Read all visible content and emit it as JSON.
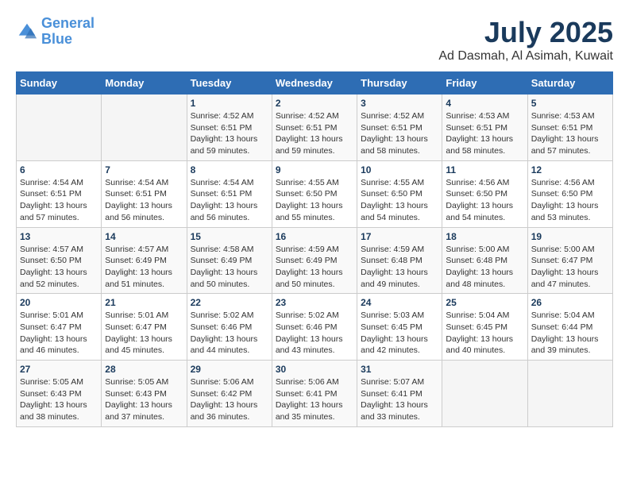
{
  "logo": {
    "line1": "General",
    "line2": "Blue"
  },
  "title": "July 2025",
  "location": "Ad Dasmah, Al Asimah, Kuwait",
  "weekdays": [
    "Sunday",
    "Monday",
    "Tuesday",
    "Wednesday",
    "Thursday",
    "Friday",
    "Saturday"
  ],
  "weeks": [
    [
      {
        "day": "",
        "detail": ""
      },
      {
        "day": "",
        "detail": ""
      },
      {
        "day": "1",
        "detail": "Sunrise: 4:52 AM\nSunset: 6:51 PM\nDaylight: 13 hours\nand 59 minutes."
      },
      {
        "day": "2",
        "detail": "Sunrise: 4:52 AM\nSunset: 6:51 PM\nDaylight: 13 hours\nand 59 minutes."
      },
      {
        "day": "3",
        "detail": "Sunrise: 4:52 AM\nSunset: 6:51 PM\nDaylight: 13 hours\nand 58 minutes."
      },
      {
        "day": "4",
        "detail": "Sunrise: 4:53 AM\nSunset: 6:51 PM\nDaylight: 13 hours\nand 58 minutes."
      },
      {
        "day": "5",
        "detail": "Sunrise: 4:53 AM\nSunset: 6:51 PM\nDaylight: 13 hours\nand 57 minutes."
      }
    ],
    [
      {
        "day": "6",
        "detail": "Sunrise: 4:54 AM\nSunset: 6:51 PM\nDaylight: 13 hours\nand 57 minutes."
      },
      {
        "day": "7",
        "detail": "Sunrise: 4:54 AM\nSunset: 6:51 PM\nDaylight: 13 hours\nand 56 minutes."
      },
      {
        "day": "8",
        "detail": "Sunrise: 4:54 AM\nSunset: 6:51 PM\nDaylight: 13 hours\nand 56 minutes."
      },
      {
        "day": "9",
        "detail": "Sunrise: 4:55 AM\nSunset: 6:50 PM\nDaylight: 13 hours\nand 55 minutes."
      },
      {
        "day": "10",
        "detail": "Sunrise: 4:55 AM\nSunset: 6:50 PM\nDaylight: 13 hours\nand 54 minutes."
      },
      {
        "day": "11",
        "detail": "Sunrise: 4:56 AM\nSunset: 6:50 PM\nDaylight: 13 hours\nand 54 minutes."
      },
      {
        "day": "12",
        "detail": "Sunrise: 4:56 AM\nSunset: 6:50 PM\nDaylight: 13 hours\nand 53 minutes."
      }
    ],
    [
      {
        "day": "13",
        "detail": "Sunrise: 4:57 AM\nSunset: 6:50 PM\nDaylight: 13 hours\nand 52 minutes."
      },
      {
        "day": "14",
        "detail": "Sunrise: 4:57 AM\nSunset: 6:49 PM\nDaylight: 13 hours\nand 51 minutes."
      },
      {
        "day": "15",
        "detail": "Sunrise: 4:58 AM\nSunset: 6:49 PM\nDaylight: 13 hours\nand 50 minutes."
      },
      {
        "day": "16",
        "detail": "Sunrise: 4:59 AM\nSunset: 6:49 PM\nDaylight: 13 hours\nand 50 minutes."
      },
      {
        "day": "17",
        "detail": "Sunrise: 4:59 AM\nSunset: 6:48 PM\nDaylight: 13 hours\nand 49 minutes."
      },
      {
        "day": "18",
        "detail": "Sunrise: 5:00 AM\nSunset: 6:48 PM\nDaylight: 13 hours\nand 48 minutes."
      },
      {
        "day": "19",
        "detail": "Sunrise: 5:00 AM\nSunset: 6:47 PM\nDaylight: 13 hours\nand 47 minutes."
      }
    ],
    [
      {
        "day": "20",
        "detail": "Sunrise: 5:01 AM\nSunset: 6:47 PM\nDaylight: 13 hours\nand 46 minutes."
      },
      {
        "day": "21",
        "detail": "Sunrise: 5:01 AM\nSunset: 6:47 PM\nDaylight: 13 hours\nand 45 minutes."
      },
      {
        "day": "22",
        "detail": "Sunrise: 5:02 AM\nSunset: 6:46 PM\nDaylight: 13 hours\nand 44 minutes."
      },
      {
        "day": "23",
        "detail": "Sunrise: 5:02 AM\nSunset: 6:46 PM\nDaylight: 13 hours\nand 43 minutes."
      },
      {
        "day": "24",
        "detail": "Sunrise: 5:03 AM\nSunset: 6:45 PM\nDaylight: 13 hours\nand 42 minutes."
      },
      {
        "day": "25",
        "detail": "Sunrise: 5:04 AM\nSunset: 6:45 PM\nDaylight: 13 hours\nand 40 minutes."
      },
      {
        "day": "26",
        "detail": "Sunrise: 5:04 AM\nSunset: 6:44 PM\nDaylight: 13 hours\nand 39 minutes."
      }
    ],
    [
      {
        "day": "27",
        "detail": "Sunrise: 5:05 AM\nSunset: 6:43 PM\nDaylight: 13 hours\nand 38 minutes."
      },
      {
        "day": "28",
        "detail": "Sunrise: 5:05 AM\nSunset: 6:43 PM\nDaylight: 13 hours\nand 37 minutes."
      },
      {
        "day": "29",
        "detail": "Sunrise: 5:06 AM\nSunset: 6:42 PM\nDaylight: 13 hours\nand 36 minutes."
      },
      {
        "day": "30",
        "detail": "Sunrise: 5:06 AM\nSunset: 6:41 PM\nDaylight: 13 hours\nand 35 minutes."
      },
      {
        "day": "31",
        "detail": "Sunrise: 5:07 AM\nSunset: 6:41 PM\nDaylight: 13 hours\nand 33 minutes."
      },
      {
        "day": "",
        "detail": ""
      },
      {
        "day": "",
        "detail": ""
      }
    ]
  ]
}
